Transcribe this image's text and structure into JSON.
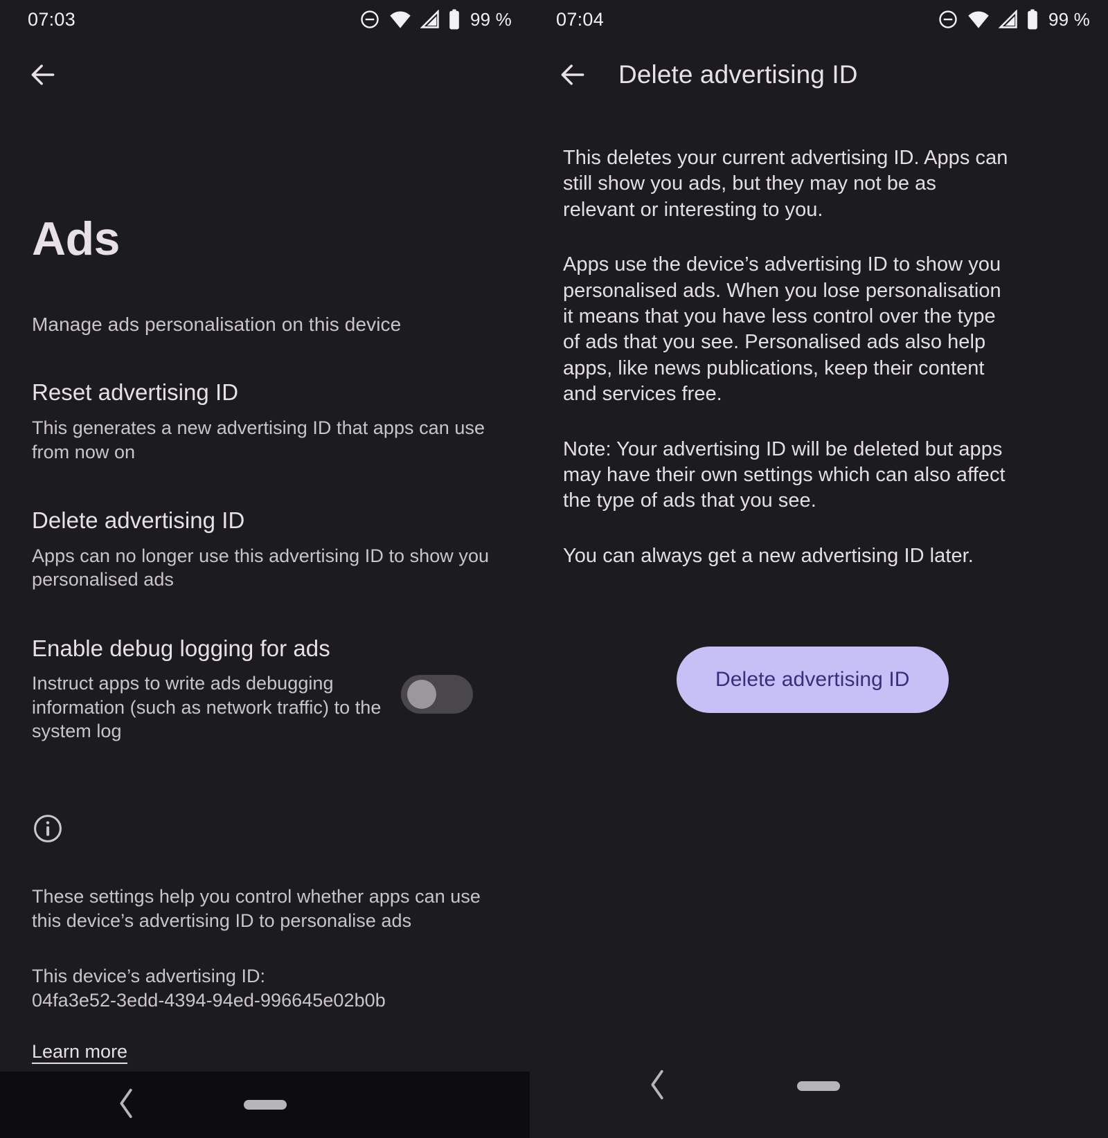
{
  "left": {
    "status": {
      "clock": "07:03",
      "battery": "99 %",
      "icons": [
        "dnd-icon",
        "wifi-icon",
        "signal-icon",
        "battery-icon"
      ]
    },
    "appbar": {
      "back": "back-arrow-icon"
    },
    "title": "Ads",
    "subtitle": "Manage ads personalisation on this device",
    "settings": [
      {
        "title": "Reset advertising ID",
        "desc": "This generates a new advertising ID that apps can use from now on"
      },
      {
        "title": "Delete advertising ID",
        "desc": "Apps can no longer use this advertising ID to show you personalised ads"
      },
      {
        "title": "Enable debug logging for ads",
        "desc": "Instruct apps to write ads debugging information (such as network traffic) to the system log",
        "toggle": "off"
      }
    ],
    "info": {
      "icon": "info-icon",
      "text": "These settings help you control whether apps can use this device’s advertising ID to personalise ads",
      "adid_label": "This device’s advertising ID:",
      "adid_value": "04fa3e52-3edd-4394-94ed-996645e02b0b",
      "learn_more": "Learn more"
    },
    "navbar": {
      "back": "nav-back-icon",
      "home": "nav-home-handle"
    }
  },
  "right": {
    "status": {
      "clock": "07:04",
      "battery": "99 %",
      "icons": [
        "dnd-icon",
        "wifi-icon",
        "signal-icon",
        "battery-icon"
      ]
    },
    "appbar": {
      "back": "back-arrow-icon",
      "title": "Delete advertising ID"
    },
    "paragraphs": [
      "This deletes your current advertising ID. Apps can still show you ads, but they may not be as relevant or interesting to you.",
      "Apps use the device’s advertising ID to show you personalised ads. When you lose personalisation it means that you have less control over the type of ads that you see. Personalised ads also help apps, like news publications, keep their content and services free.",
      "Note: Your advertising ID will be deleted but apps may have their own settings which can also affect the type of ads that you see.",
      "You can always get a new advertising ID later."
    ],
    "action_button": "Delete advertising ID",
    "navbar": {
      "back": "nav-back-icon",
      "home": "nav-home-handle"
    }
  },
  "colors": {
    "background": "#1c1b1f",
    "navbar_background": "#0d0d0f",
    "primary_text": "#e7e1e7",
    "secondary_text": "#c9c5ca",
    "accent_button_bg": "#c6c0f7",
    "accent_button_text": "#372f7e",
    "switch_track": "#49474b",
    "switch_knob": "#9a989d"
  }
}
